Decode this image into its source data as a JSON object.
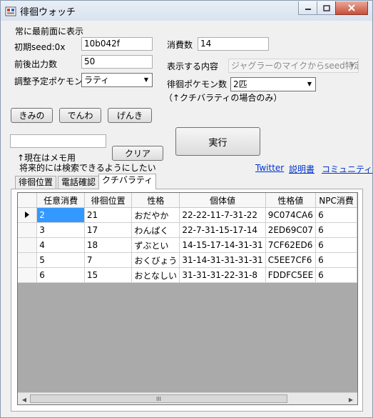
{
  "window": {
    "title": "徘徊ウォッチ"
  },
  "topmost_label": "常に最前面に表示",
  "fields": {
    "seed_label": "初期seed:0x",
    "seed_value": "10b042f",
    "range_label": "前後出力数",
    "range_value": "50",
    "pokemon_label": "調整予定ポケモン",
    "pokemon_value": "ラティ",
    "consume_label": "消費数",
    "consume_value": "14",
    "display_label": "表示する内容",
    "display_value": "ジャグラーのマイクからseed特定",
    "roamer_label": "徘徊ポケモン数",
    "roamer_value": "2匹",
    "roamer_note": "（↑クチバラティの場合のみ）"
  },
  "buttons": {
    "kimino": "きみの",
    "denwa": "でんわ",
    "genki": "げんき",
    "run": "実行",
    "clear": "クリア"
  },
  "memo": {
    "value": "",
    "note_line1": "↑現在はメモ用",
    "note_line2": "将来的には検索できるようにしたい"
  },
  "links": {
    "twitter": "Twitter",
    "manual": "説明書",
    "community": "コミュニティ"
  },
  "tabs": [
    "徘徊位置",
    "電話確認",
    "クチバラティ"
  ],
  "table": {
    "columns": [
      "任意消費",
      "徘徊位置",
      "性格",
      "個体値",
      "性格値",
      "NPC消費"
    ],
    "rows": [
      [
        "2",
        "21",
        "おだやか",
        "22-22-11-7-31-22",
        "9C074CA6",
        "6"
      ],
      [
        "3",
        "17",
        "わんぱく",
        "22-7-31-15-17-14",
        "2ED69C07",
        "6"
      ],
      [
        "4",
        "18",
        "ずぶとい",
        "14-15-17-14-31-31",
        "7CF62ED6",
        "6"
      ],
      [
        "5",
        "7",
        "おくびょう",
        "31-14-31-31-31-31",
        "C5EE7CF6",
        "6"
      ],
      [
        "6",
        "15",
        "おとなしい",
        "31-31-31-22-31-8",
        "FDDFC5EE",
        "6"
      ]
    ]
  },
  "scrollbar_grip": "III"
}
